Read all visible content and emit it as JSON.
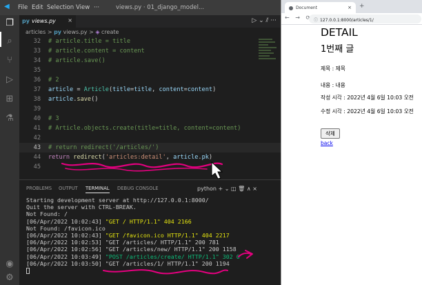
{
  "vscode": {
    "menu": [
      "File",
      "Edit",
      "Selection",
      "View",
      "···"
    ],
    "window_title": "views.py · 01_django_model...",
    "tab": {
      "label": "views.py",
      "lang": "py",
      "close": "×"
    },
    "editor_actions": "▷ ⌄  ⫽  ···",
    "breadcrumb": {
      "folder": "articles",
      "sep1": ">",
      "file": "views.py",
      "sep2": ">",
      "symbol": "create"
    },
    "terminal_tools": "python  +  ⌄  ◫  🗑  ∧  ×",
    "panel_tabs": [
      "PROBLEMS",
      "OUTPUT",
      "TERMINAL",
      "DEBUG CONSOLE"
    ],
    "terminal_lines": [
      "Starting development server at http://127.0.0.1:8000/",
      "Quit the server with CTRL-BREAK.",
      "Not Found: /",
      "[06/Apr/2022 10:02:43] ",
      "Not Found: /favicon.ico",
      "[06/Apr/2022 10:02:43] ",
      "[06/Apr/2022 10:02:53] ",
      "[06/Apr/2022 10:02:56] ",
      "[06/Apr/2022 10:03:49] ",
      "[06/Apr/2022 10:03:50] "
    ],
    "terminal_requests": {
      "r3": "\"GET / HTTP/1.1\" 404 2166",
      "r5": "\"GET /favicon.ico HTTP/1.1\" 404 2217",
      "r6": "\"GET /articles/ HTTP/1.1\" 200 781",
      "r7": "\"GET /articles/new/ HTTP/1.1\" 200 1158",
      "r8": "\"POST /articles/create/ HTTP/1.1\" 302 0",
      "r9": "\"GET /articles/1/ HTTP/1.1\" 200 1194"
    },
    "code_lines": {
      "l32": {
        "num": "32",
        "text": "# article.title = title"
      },
      "l33": {
        "num": "33",
        "text": "# article.content = content"
      },
      "l34": {
        "num": "34",
        "text": "# article.save()"
      },
      "l35": {
        "num": "35"
      },
      "l36": {
        "num": "36",
        "text": "# 2"
      },
      "l37": {
        "num": "37",
        "a": "article",
        "b": " = ",
        "c": "Article",
        "d": "(",
        "e": "title",
        "f": "=",
        "g": "title",
        "h": ", ",
        "i": "content",
        "j": "=",
        "k": "content",
        "l": ")"
      },
      "l38": {
        "num": "38",
        "a": "article",
        "b": ".",
        "c": "save",
        "d": "()"
      },
      "l39": {
        "num": "39"
      },
      "l40": {
        "num": "40",
        "text": "# 3"
      },
      "l41": {
        "num": "41",
        "text": "# Article.objects.create(title=title, content=content)"
      },
      "l42": {
        "num": "42"
      },
      "l43": {
        "num": "43",
        "text": "# return redirect('/articles/')"
      },
      "l44": {
        "num": "44",
        "a": "return",
        "b": " ",
        "c": "redirect",
        "d": "(",
        "e": "'articles:detail'",
        "f": ", ",
        "g": "article",
        "h": ".",
        "i": "pk",
        "j": ")"
      },
      "l45": {
        "num": "45"
      }
    }
  },
  "browser": {
    "tab_title": "Document",
    "tab_close": "×",
    "new_tab": "+",
    "nav": "← → ⟳",
    "url": "127.0.0.1:8000/articles/1/",
    "page": {
      "h1": "DETAIL",
      "h2": "1번째 글",
      "title_line": "제목 : 제목",
      "content_line": "내용 : 내용",
      "created_line": "작성 시각 : 2022년 4월 6일 10:03 오전",
      "updated_line": "수정 시각 : 2022년 4월 6일 10:03 오전",
      "delete_button": "삭제",
      "back_link": "back"
    }
  },
  "colors": {
    "editor_bg": "#1e1e1e",
    "comment": "#6a9955",
    "annotation_pen": "#e4007f",
    "terminal_yellow": "#e5e510",
    "terminal_green": "#0dbc79"
  }
}
